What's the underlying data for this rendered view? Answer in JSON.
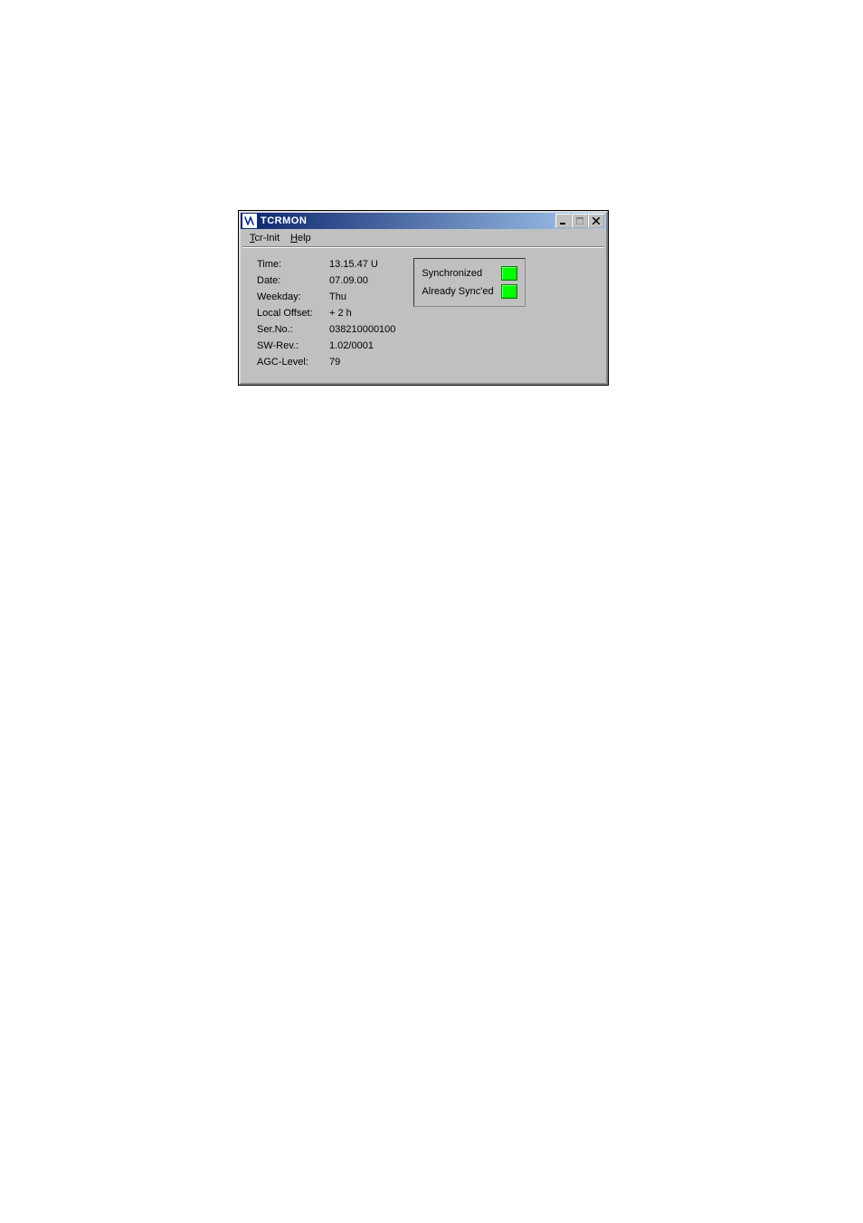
{
  "window": {
    "title": "TCRMON"
  },
  "menubar": {
    "tcr_init": "Tcr-Init",
    "help": "Help"
  },
  "info": {
    "time_label": "Time:",
    "time_value": "13.15.47 U",
    "date_label": "Date:",
    "date_value": "07.09.00",
    "weekday_label": "Weekday:",
    "weekday_value": "Thu",
    "local_offset_label": "Local Offset:",
    "local_offset_value": "+ 2 h",
    "serno_label": "Ser.No.:",
    "serno_value": "038210000100",
    "swrev_label": "SW-Rev.:",
    "swrev_value": "1.02/0001",
    "agc_label": "AGC-Level:",
    "agc_value": "79"
  },
  "status": {
    "synchronized": "Synchronized",
    "already_synced": "Already Sync'ed"
  }
}
